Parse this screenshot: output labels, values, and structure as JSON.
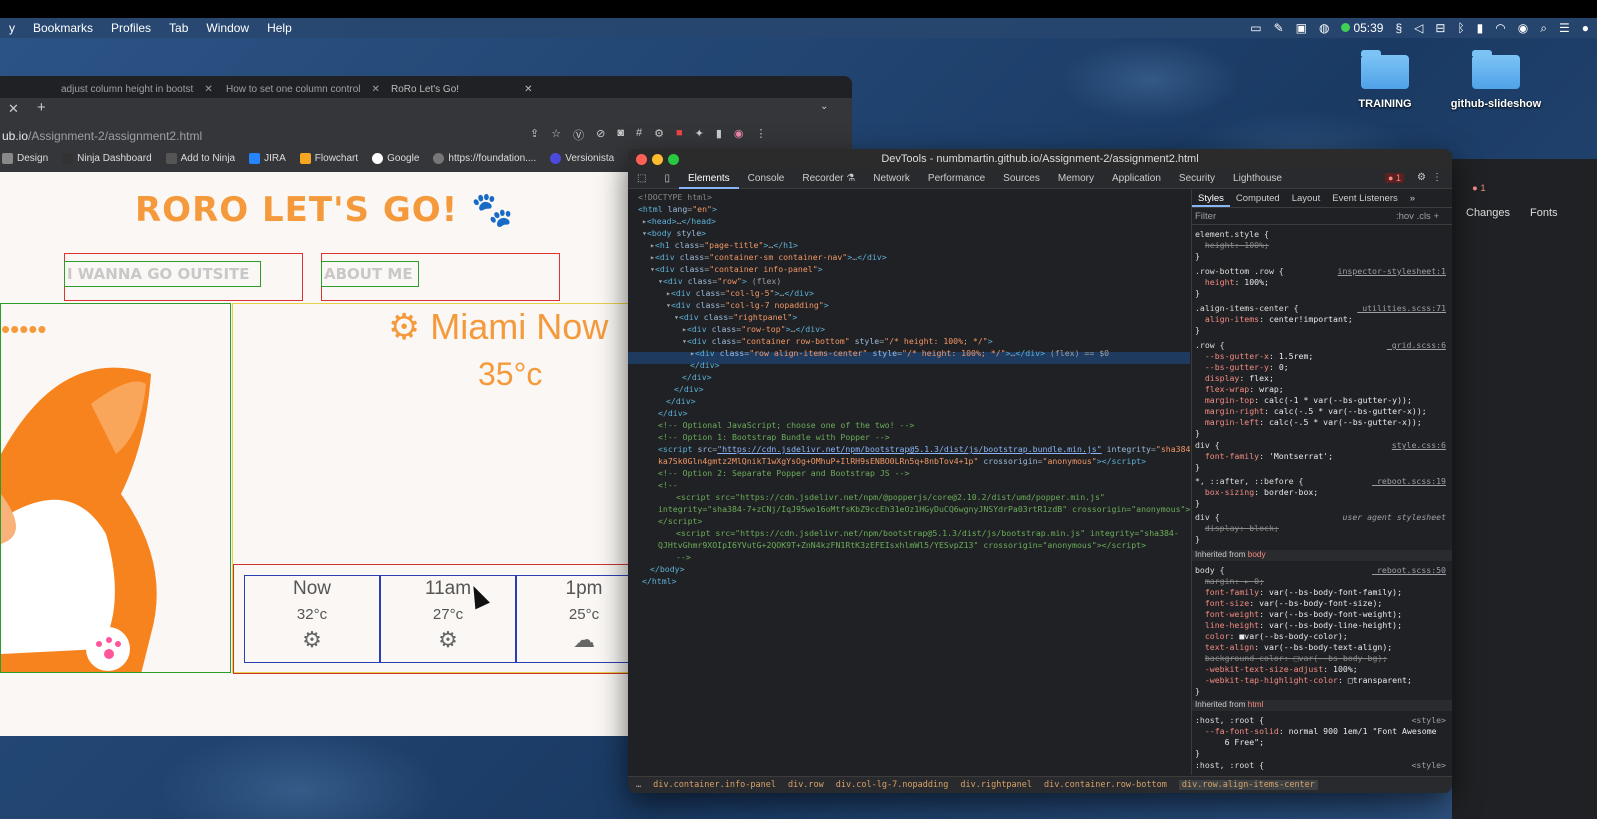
{
  "menubar": {
    "items": [
      "y",
      "Bookmarks",
      "Profiles",
      "Tab",
      "Window",
      "Help"
    ],
    "clock": "05:39"
  },
  "desktop": {
    "folders": [
      "TRAINING",
      "github-slideshow"
    ]
  },
  "browser": {
    "tabs": [
      "adjust column height in bootst",
      "How to set one column control",
      "RoRo Let's Go!"
    ],
    "url_host": "ub.io",
    "url_path": "/Assignment-2/assignment2.html",
    "bookmarks": [
      "Design",
      "Ninja Dashboard",
      "Add to Ninja",
      "JIRA",
      "Flowchart",
      "Google",
      "https://foundation....",
      "Versionista"
    ]
  },
  "site": {
    "title": "RORO LET'S GO! 🐾",
    "nav": [
      "I WANNA GO OUTSITE",
      "ABOUT ME"
    ],
    "city": "Miami Now",
    "temp": "35°c",
    "hours": [
      {
        "time": "Now",
        "temp": "32°c",
        "icon": "⚙"
      },
      {
        "time": "11am",
        "temp": "27°c",
        "icon": "⚙"
      },
      {
        "time": "1pm",
        "temp": "25°c",
        "icon": "☁"
      }
    ]
  },
  "devtools": {
    "title": "DevTools - numbmartin.github.io/Assignment-2/assignment2.html",
    "tabs": [
      "Elements",
      "Console",
      "Recorder ⚗",
      "Network",
      "Performance",
      "Sources",
      "Memory",
      "Application",
      "Security",
      "Lighthouse"
    ],
    "error_count": "1",
    "style_tabs": [
      "Styles",
      "Computed",
      "Layout",
      "Event Listeners",
      "»"
    ],
    "filter_placeholder": "Filter",
    "filter_tools": ":hov  .cls  +",
    "breadcrumbs": [
      "div.container.info-panel",
      "div.row",
      "div.col-lg-7.nopadding",
      "div.rightpanel",
      "div.container.row-bottom",
      "div.row.align-items-center"
    ]
  },
  "right_panel": {
    "changes": "Changes",
    "fonts": "Fonts",
    "badge": "1"
  }
}
